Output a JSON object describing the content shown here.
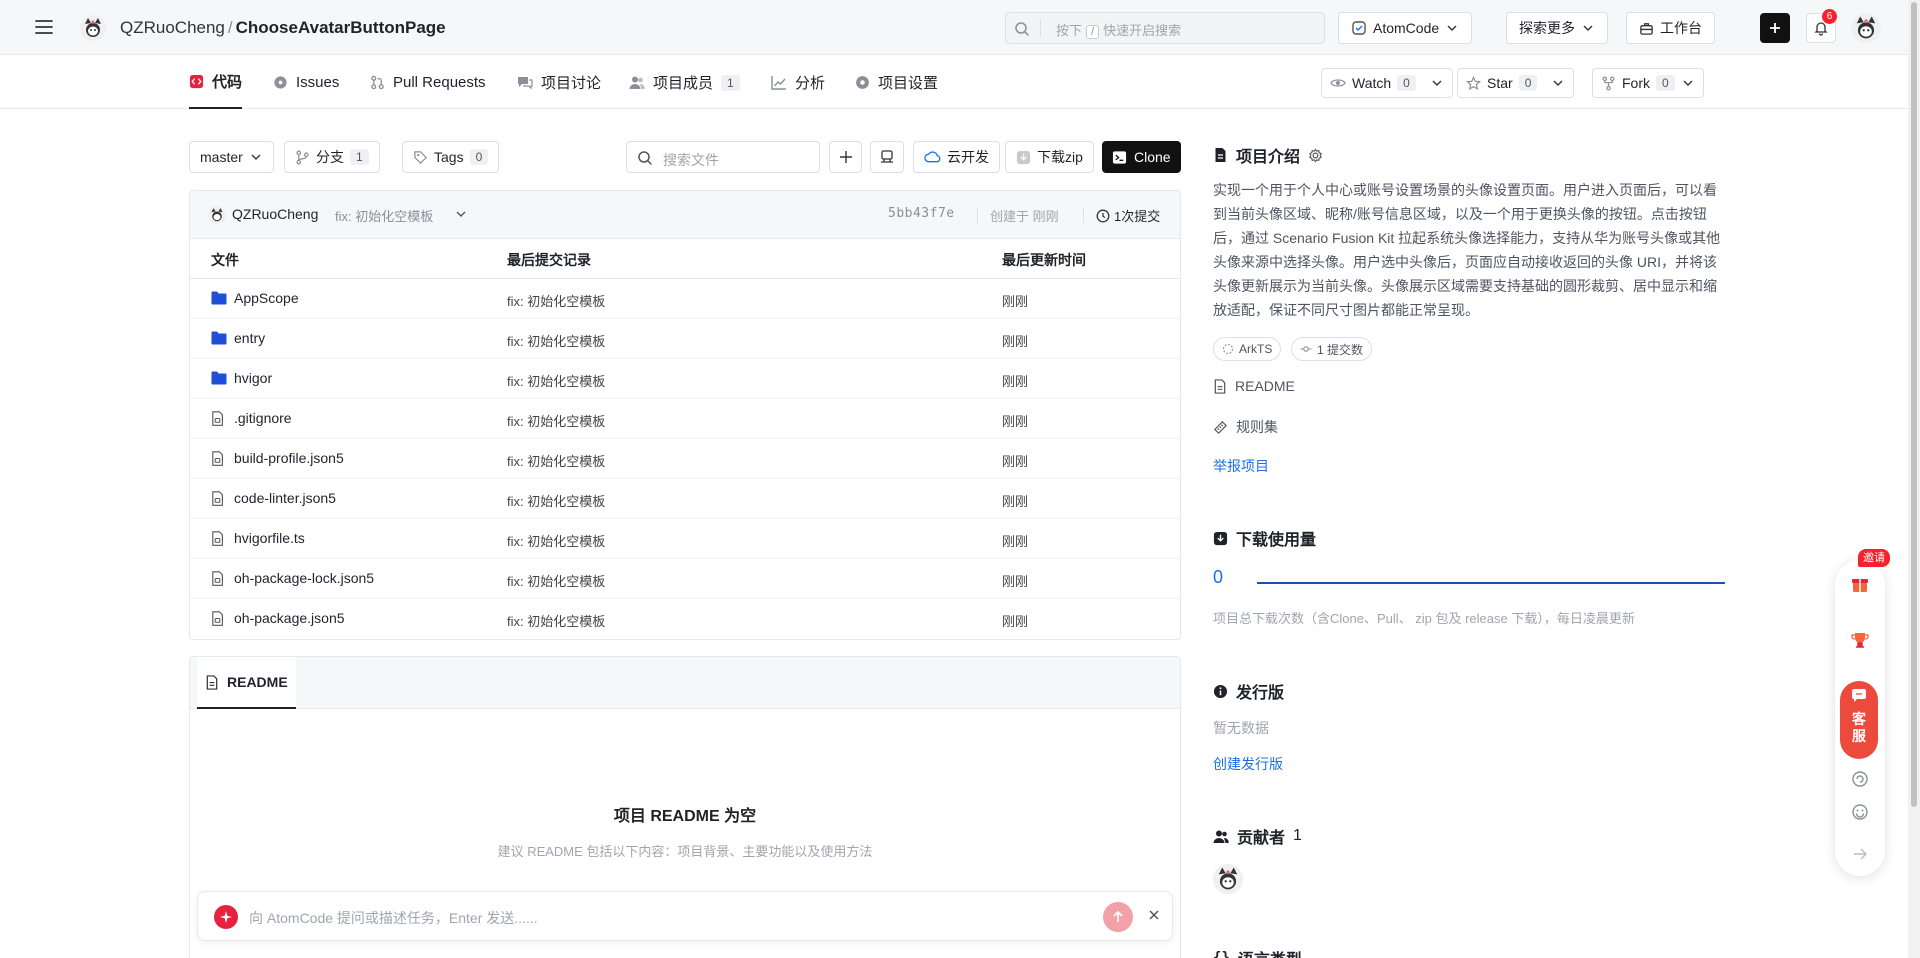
{
  "topbar": {
    "owner": "QZRuoCheng",
    "separator": "/",
    "repo": "ChooseAvatarButtonPage",
    "search_prefix": "按下",
    "search_key": "/",
    "search_suffix": "快速开启搜索",
    "atomcode_label": "AtomCode",
    "explore_label": "探索更多",
    "workbench_label": "工作台",
    "notification_count": "6"
  },
  "repo_tabs": [
    {
      "label": "代码",
      "icon": "code-icon"
    },
    {
      "label": "Issues",
      "icon": "issues-icon"
    },
    {
      "label": "Pull Requests",
      "icon": "pull-request-icon"
    },
    {
      "label": "项目讨论",
      "icon": "discussion-icon"
    },
    {
      "label": "项目成员",
      "icon": "members-icon",
      "count": "1"
    },
    {
      "label": "分析",
      "icon": "chart-icon"
    },
    {
      "label": "项目设置",
      "icon": "settings-icon"
    }
  ],
  "social": {
    "watch_label": "Watch",
    "watch_count": "0",
    "star_label": "Star",
    "star_count": "0",
    "fork_label": "Fork",
    "fork_count": "0"
  },
  "toolbar": {
    "branch": "master",
    "branches_label": "分支",
    "branches_count": "1",
    "tags_label": "Tags",
    "tags_count": "0",
    "search_placeholder": "搜索文件",
    "cloud_dev_label": "云开发",
    "download_zip_label": "下载zip",
    "clone_label": "Clone"
  },
  "commit": {
    "author": "QZRuoCheng",
    "message": "fix: 初始化空模板",
    "sha": "5bb43f7e",
    "created": "创建于 刚刚",
    "commits": "1次提交"
  },
  "table": {
    "headers": [
      "文件",
      "最后提交记录",
      "最后更新时间"
    ],
    "rows": [
      {
        "name": "AppScope",
        "type": "folder",
        "message": "fix: 初始化空模板",
        "time": "刚刚"
      },
      {
        "name": "entry",
        "type": "folder",
        "message": "fix: 初始化空模板",
        "time": "刚刚"
      },
      {
        "name": "hvigor",
        "type": "folder",
        "message": "fix: 初始化空模板",
        "time": "刚刚"
      },
      {
        "name": ".gitignore",
        "type": "file",
        "message": "fix: 初始化空模板",
        "time": "刚刚"
      },
      {
        "name": "build-profile.json5",
        "type": "file",
        "message": "fix: 初始化空模板",
        "time": "刚刚"
      },
      {
        "name": "code-linter.json5",
        "type": "file",
        "message": "fix: 初始化空模板",
        "time": "刚刚"
      },
      {
        "name": "hvigorfile.ts",
        "type": "file",
        "message": "fix: 初始化空模板",
        "time": "刚刚"
      },
      {
        "name": "oh-package-lock.json5",
        "type": "file",
        "message": "fix: 初始化空模板",
        "time": "刚刚"
      },
      {
        "name": "oh-package.json5",
        "type": "file",
        "message": "fix: 初始化空模板",
        "time": "刚刚"
      }
    ]
  },
  "readme": {
    "tab_label": "README",
    "empty_title": "项目 README 为空",
    "empty_hint": "建议 README 包括以下内容：项目背景、主要功能以及使用方法"
  },
  "atom_input": {
    "placeholder": "向 AtomCode 提问或描述任务，Enter 发送......"
  },
  "sidebar": {
    "intro_title": "项目介绍",
    "intro_text": "实现一个用于个人中心或账号设置场景的头像设置页面。用户进入页面后，可以看到当前头像区域、昵称/账号信息区域，以及一个用于更换头像的按钮。点击按钮后，通过 Scenario Fusion Kit 拉起系统头像选择能力，支持从华为账号头像或其他头像来源中选择头像。用户选中头像后，页面应自动接收返回的头像 URI，并将该头像更新展示为当前头像。头像展示区域需要支持基础的圆形裁剪、居中显示和缩放适配，保证不同尺寸图片都能正常呈现。",
    "lang_tag": "ArkTS",
    "commit_tag": "1 提交数",
    "readme_link": "README",
    "ruleset_link": "规则集",
    "report_link": "举报项目",
    "download_title": "下载使用量",
    "download_value": "0",
    "download_note": "项目总下载次数（含Clone、Pull、 zip 包及 release 下载），每日凌晨更新",
    "release_title": "发行版",
    "release_empty": "暂无数据",
    "release_create": "创建发行版",
    "contributors_title": "贡献者",
    "contributors_count": "1",
    "lang_title": "语言类型"
  },
  "float_widget": {
    "invite_label": "邀请",
    "service_label_1": "客",
    "service_label_2": "服"
  }
}
